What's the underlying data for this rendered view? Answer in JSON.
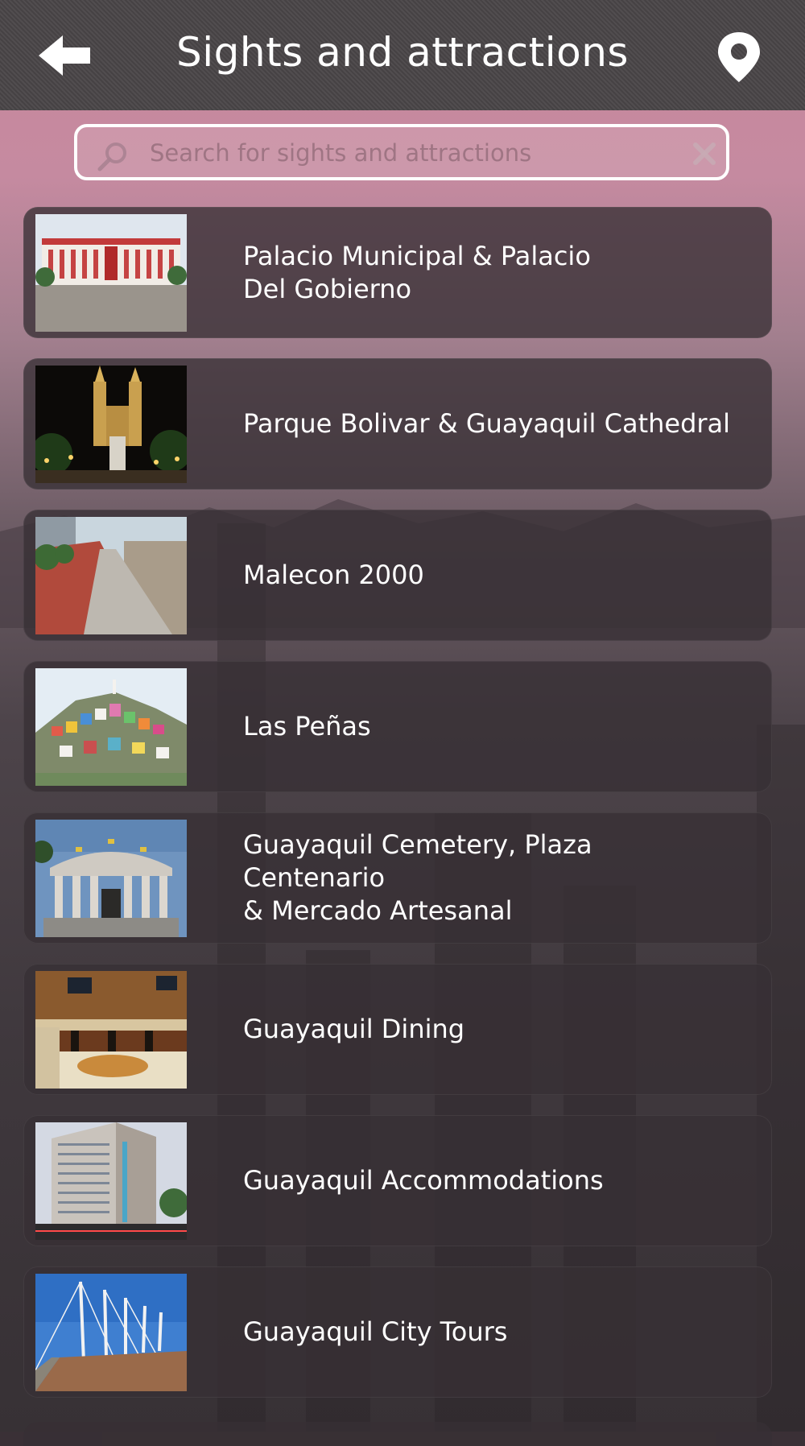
{
  "header": {
    "title": "Sights and attractions",
    "back_icon": "back-arrow-icon",
    "map_icon": "map-pin-icon"
  },
  "search": {
    "placeholder": "Search for sights and attractions",
    "value": "",
    "icon": "search-icon",
    "clear_icon": "clear-x-icon"
  },
  "colors": {
    "header_bg": "#4a4648",
    "card_bg": "rgba(55,48,52,0.78)",
    "text": "#ffffff",
    "sky_pink": "#c9879c"
  },
  "items": [
    {
      "label": "Palacio Municipal & Palacio\nDel Gobierno",
      "thumb": "palace-photo"
    },
    {
      "label": "Parque Bolivar & Guayaquil Cathedral",
      "thumb": "cathedral-night-photo"
    },
    {
      "label": "Malecon 2000",
      "thumb": "boardwalk-photo"
    },
    {
      "label": "Las Peñas",
      "thumb": "hillside-houses-photo"
    },
    {
      "label": "Guayaquil Cemetery, Plaza Centenario\n& Mercado Artesanal",
      "thumb": "monument-photo"
    },
    {
      "label": "Guayaquil Dining",
      "thumb": "restaurant-photo"
    },
    {
      "label": "Guayaquil Accommodations",
      "thumb": "hotel-photo"
    },
    {
      "label": "Guayaquil City Tours",
      "thumb": "bridge-masts-photo"
    }
  ]
}
